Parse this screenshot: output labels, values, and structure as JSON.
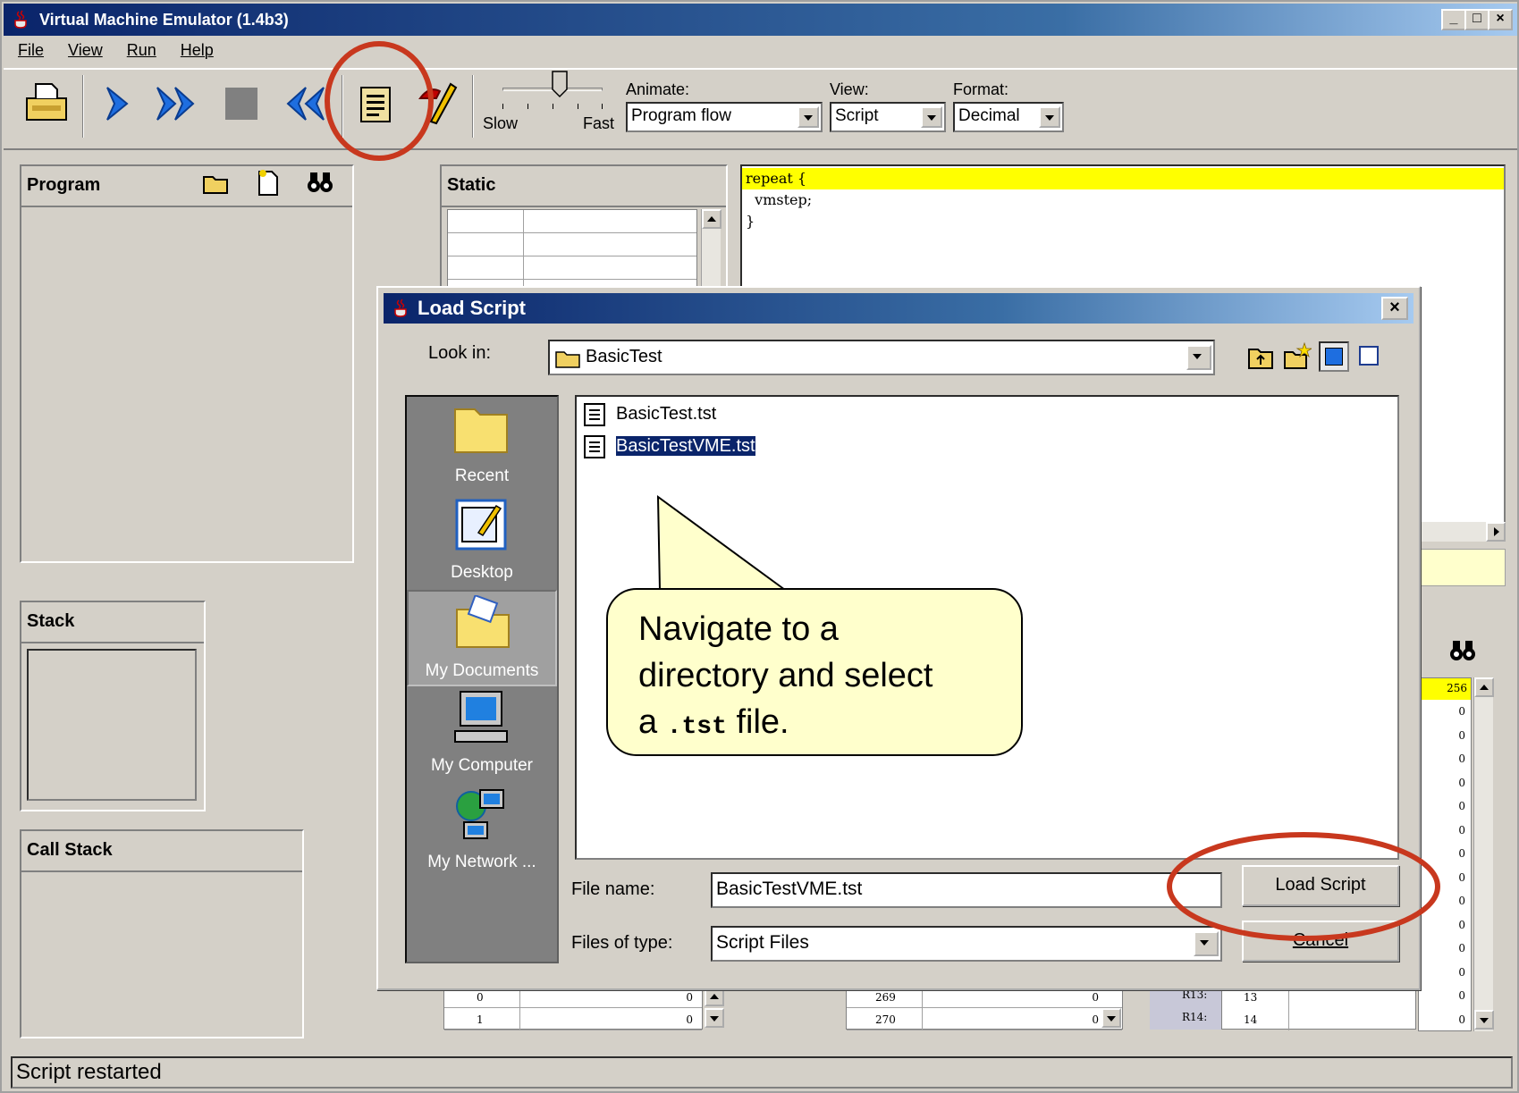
{
  "window": {
    "title": "Virtual Machine Emulator (1.4b3)",
    "controls": [
      "_",
      "□",
      "×"
    ]
  },
  "menu": {
    "items": [
      "File",
      "View",
      "Run",
      "Help"
    ]
  },
  "toolbar": {
    "slider_slow": "Slow",
    "slider_fast": "Fast",
    "animate_label": "Animate:",
    "animate_value": "Program flow",
    "view_label": "View:",
    "view_value": "Script",
    "format_label": "Format:",
    "format_value": "Decimal"
  },
  "panels": {
    "program": "Program",
    "static": "Static",
    "stack": "Stack",
    "call_stack": "Call Stack"
  },
  "script": {
    "lines": [
      "repeat {",
      "  vmstep;",
      "}"
    ]
  },
  "bottom_tables": {
    "static_rows": [
      {
        "idx": "0",
        "val": "0"
      },
      {
        "idx": "1",
        "val": "0"
      }
    ],
    "mid_rows": [
      {
        "idx": "269",
        "val": "0"
      },
      {
        "idx": "270",
        "val": "0"
      }
    ],
    "reg_rows": [
      {
        "name": "R13:",
        "val": "13"
      },
      {
        "name": "R14:",
        "val": "14"
      }
    ],
    "right_col_top": "256",
    "right_col_vals": [
      "0",
      "0",
      "0",
      "0",
      "0",
      "0",
      "0",
      "0",
      "0",
      "0",
      "0",
      "0",
      "0",
      "0"
    ]
  },
  "status": {
    "text": "Script restarted"
  },
  "dialog": {
    "title": "Load Script",
    "look_in_label": "Look in:",
    "look_in_value": "BasicTest",
    "places": [
      "Recent",
      "Desktop",
      "My Documents",
      "My Computer",
      "My Network ..."
    ],
    "files": [
      "BasicTest.tst",
      "BasicTestVME.tst"
    ],
    "file_name_label": "File name:",
    "file_name_value": "BasicTestVME.tst",
    "files_of_type_label": "Files of type:",
    "files_of_type_value": "Script Files",
    "load_button": "Load Script",
    "cancel_button": "Cancel"
  },
  "callout": {
    "line1": "Navigate to a",
    "line2": "directory and select",
    "line3_pre": "a",
    "line3_code": ".tst",
    "line3_post": "file."
  },
  "colors": {
    "highlight_yellow": "#ffff00",
    "annotation_red": "#c8381e",
    "callout_fill": "#ffffcc",
    "title_blue": "#0a246a"
  }
}
